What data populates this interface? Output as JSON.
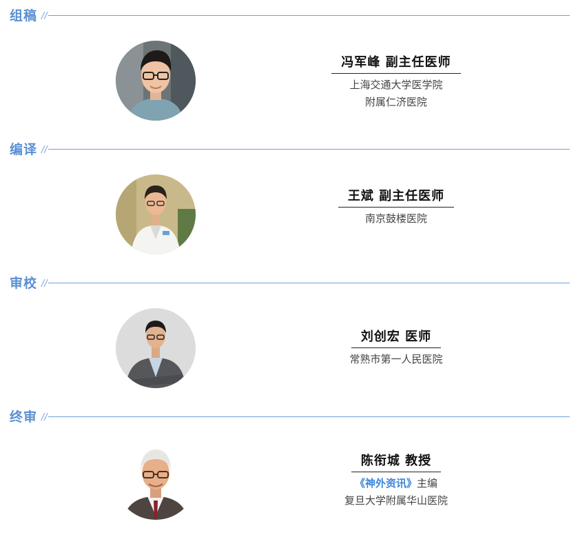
{
  "sections": [
    {
      "title": "组稿",
      "slash": "//",
      "person": {
        "name": "冯军峰 副主任医师",
        "lines": [
          "上海交通大学医学院",
          "附属仁济医院"
        ]
      }
    },
    {
      "title": "编译",
      "slash": "//",
      "person": {
        "name": "王斌 副主任医师",
        "lines": [
          "南京鼓楼医院"
        ]
      }
    },
    {
      "title": "审校",
      "slash": "//",
      "person": {
        "name": "刘创宏 医师",
        "lines": [
          "常熟市第一人民医院"
        ]
      }
    },
    {
      "title": "终审",
      "slash": "//",
      "person": {
        "name": "陈衔城 教授",
        "journal": "《神外资讯》",
        "role": "主编",
        "lines": [
          "复旦大学附属华山医院"
        ]
      }
    }
  ],
  "colors": {
    "section_title": "#5b8fd3",
    "divider": "#6f9fdc",
    "journal_highlight": "#3d86d8",
    "name_text": "#111111",
    "org_text": "#444444"
  },
  "icons": {
    "avatar": "person-photo"
  }
}
